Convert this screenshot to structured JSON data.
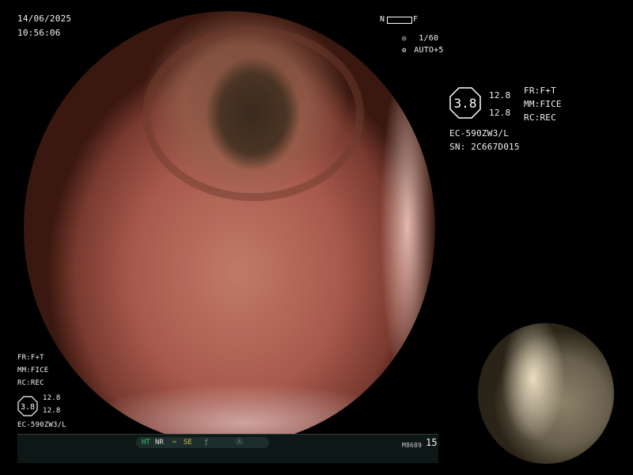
{
  "datetime": {
    "date": "14/06/2025",
    "time": "10:56:06"
  },
  "focus_indicator": {
    "left_label": "N",
    "right_label": "F"
  },
  "shutter": {
    "speed": "1/60",
    "exposure": "AUTO+5"
  },
  "scope_info": {
    "badge_value": "3.8",
    "setting_top": "12.8",
    "setting_bottom": "12.8",
    "fr": "FR:F+T",
    "mm": "MM:FICE",
    "rc": "RC:REC",
    "model": "EC-590ZW3/L",
    "serial": "SN: 2C667D015"
  },
  "bottom_left_info": {
    "fr": "FR:F+T",
    "mm": "MM:FICE",
    "rc": "RC:REC",
    "badge_value": "3.8",
    "setting_top": "12.8",
    "setting_bottom": "12.8",
    "model": "EC-590ZW3/L"
  },
  "status_bar": {
    "ht_label": "HT",
    "nr_label": "NR",
    "se_label": "SE",
    "code": "M8689",
    "number": "15"
  },
  "colors": {
    "status_green": "#3ec46d",
    "status_yellow": "#d6c24a",
    "bar_bg": "#0d1716"
  }
}
